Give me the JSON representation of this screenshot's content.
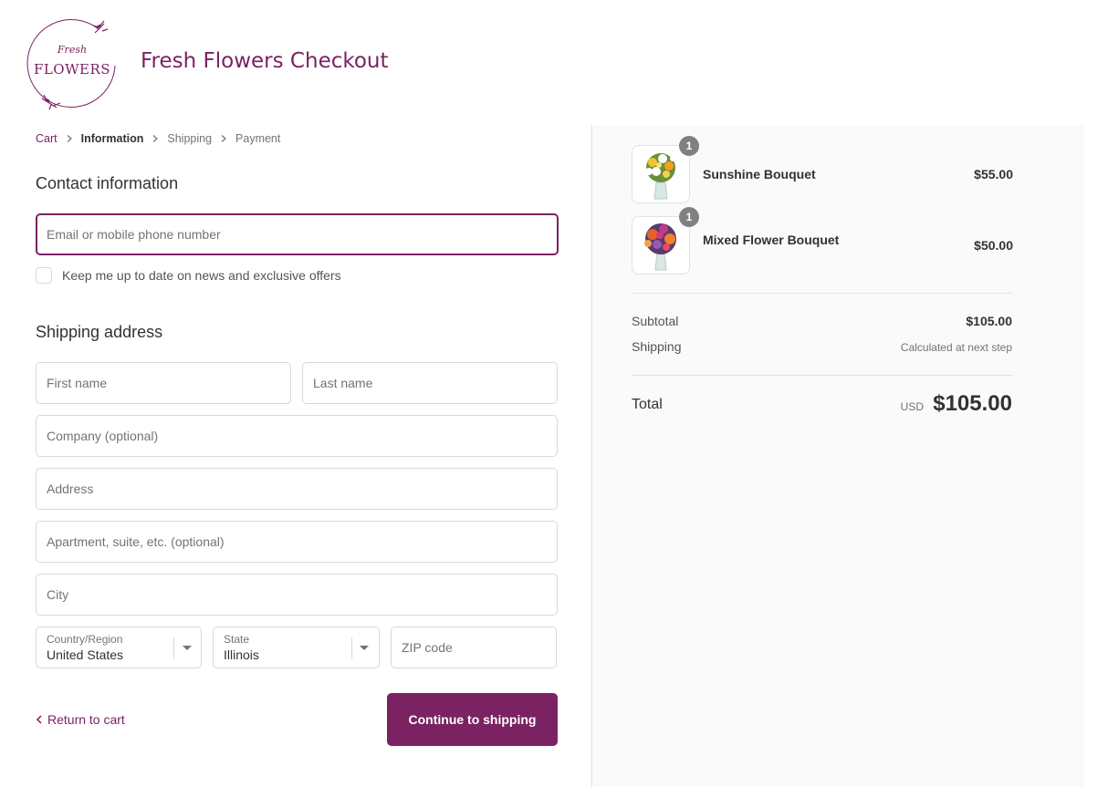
{
  "brand": {
    "logo_top": "Fresh",
    "logo_bottom": "FLOWERS",
    "title": "Fresh Flowers Checkout",
    "accent_color": "#7a2262"
  },
  "breadcrumb": {
    "items": [
      "Cart",
      "Information",
      "Shipping",
      "Payment"
    ],
    "separator_icon": "chevron-right-icon"
  },
  "contact": {
    "title": "Contact information",
    "email_placeholder": "Email or mobile phone number",
    "newsletter_label": "Keep me up to date on news and exclusive offers"
  },
  "shipping": {
    "title": "Shipping address",
    "first_name_placeholder": "First name",
    "last_name_placeholder": "Last name",
    "company_placeholder": "Company (optional)",
    "address_placeholder": "Address",
    "apartment_placeholder": "Apartment, suite, etc. (optional)",
    "city_placeholder": "City",
    "country_label": "Country/Region",
    "country_value": "United States",
    "state_label": "State",
    "state_value": "Illinois",
    "zip_placeholder": "ZIP code"
  },
  "actions": {
    "return_label": "Return to cart",
    "continue_label": "Continue to shipping"
  },
  "summary": {
    "items": [
      {
        "name": "Sunshine Bouquet",
        "price": "$55.00",
        "qty": "1"
      },
      {
        "name": "Mixed Flower Bouquet",
        "price": "$50.00",
        "qty": "1"
      }
    ],
    "subtotal_label": "Subtotal",
    "subtotal_value": "$105.00",
    "shipping_label": "Shipping",
    "shipping_value": "Calculated at next step",
    "total_label": "Total",
    "currency": "USD",
    "total_value": "$105.00"
  }
}
